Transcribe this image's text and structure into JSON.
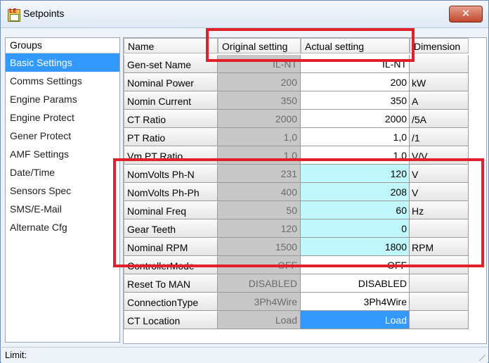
{
  "window": {
    "title": "Setpoints",
    "close_glyph": "✕"
  },
  "groups": {
    "header": "Groups",
    "items": [
      {
        "label": "Basic Settings",
        "selected": true
      },
      {
        "label": "Comms Settings"
      },
      {
        "label": "Engine Params"
      },
      {
        "label": "Engine Protect"
      },
      {
        "label": "Gener Protect"
      },
      {
        "label": "AMF Settings"
      },
      {
        "label": "Date/Time"
      },
      {
        "label": "Sensors Spec"
      },
      {
        "label": "SMS/E-Mail"
      },
      {
        "label": "Alternate Cfg"
      }
    ]
  },
  "grid": {
    "columns": [
      "Name",
      "Original setting",
      "Actual setting",
      "Dimension"
    ],
    "rows": [
      {
        "name": "Gen-set Name",
        "original": "IL-NT",
        "actual": "IL-NT",
        "dimension": ""
      },
      {
        "name": "Nominal Power",
        "original": "200",
        "actual": "200",
        "dimension": "kW"
      },
      {
        "name": "Nomin Current",
        "original": "350",
        "actual": "350",
        "dimension": "A"
      },
      {
        "name": "CT Ratio",
        "original": "2000",
        "actual": "2000",
        "dimension": "/5A"
      },
      {
        "name": "PT Ratio",
        "original": "1,0",
        "actual": "1,0",
        "dimension": "/1"
      },
      {
        "name": "Vm PT Ratio",
        "original": "1,0",
        "actual": "1,0",
        "dimension": "V/V"
      },
      {
        "name": "NomVolts Ph-N",
        "original": "231",
        "actual": "120",
        "dimension": "V",
        "changed": true
      },
      {
        "name": "NomVolts Ph-Ph",
        "original": "400",
        "actual": "208",
        "dimension": "V",
        "changed": true
      },
      {
        "name": "Nominal Freq",
        "original": "50",
        "actual": "60",
        "dimension": "Hz",
        "changed": true
      },
      {
        "name": "Gear Teeth",
        "original": "120",
        "actual": "0",
        "dimension": "",
        "changed": true
      },
      {
        "name": "Nominal RPM",
        "original": "1500",
        "actual": "1800",
        "dimension": "RPM",
        "changed": true
      },
      {
        "name": "ControllerMode",
        "original": "OFF",
        "actual": "OFF",
        "dimension": ""
      },
      {
        "name": "Reset To MAN",
        "original": "DISABLED",
        "actual": "DISABLED",
        "dimension": ""
      },
      {
        "name": "ConnectionType",
        "original": "3Ph4Wire",
        "actual": "3Ph4Wire",
        "dimension": ""
      },
      {
        "name": "CT Location",
        "original": "Load",
        "actual": "Load",
        "dimension": "",
        "selected": true
      }
    ]
  },
  "status": {
    "label": "Limit:"
  },
  "colors": {
    "highlight_border": "#e0202a",
    "changed_cell": "#bff7fb",
    "selection": "#3399ff"
  }
}
